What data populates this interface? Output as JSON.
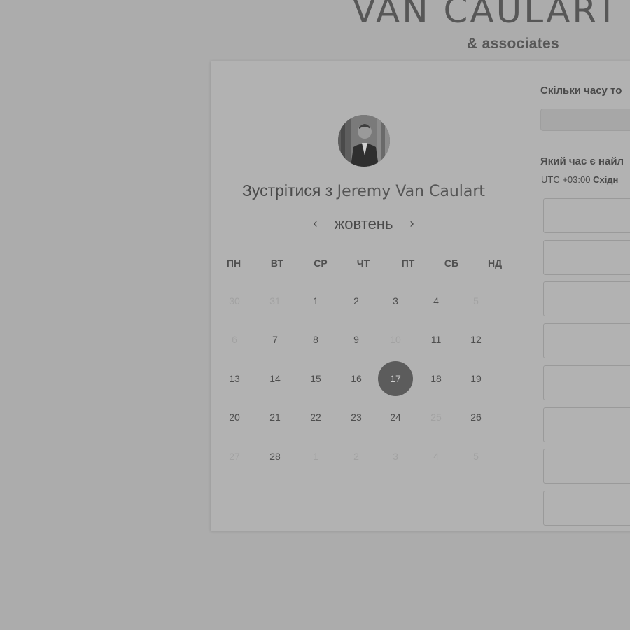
{
  "brand": {
    "title": "VAN CAULART",
    "subtitle": "& associates"
  },
  "scheduler": {
    "meet_prefix": "Зустрітися з",
    "host_name": "Jeremy Van Caulart",
    "month": "жовтень",
    "prev_arrow": "‹",
    "next_arrow": "›",
    "weekdays": [
      "ПН",
      "ВТ",
      "СР",
      "ЧТ",
      "ПТ",
      "СБ",
      "НД"
    ],
    "weeks": [
      [
        {
          "d": "30",
          "muted": true
        },
        {
          "d": "31",
          "muted": true
        },
        {
          "d": "1"
        },
        {
          "d": "2"
        },
        {
          "d": "3"
        },
        {
          "d": "4"
        },
        {
          "d": "5",
          "muted": true
        }
      ],
      [
        {
          "d": "6",
          "muted": true
        },
        {
          "d": "7"
        },
        {
          "d": "8"
        },
        {
          "d": "9"
        },
        {
          "d": "10",
          "muted": true
        },
        {
          "d": "11"
        },
        {
          "d": "12"
        }
      ],
      [
        {
          "d": "13"
        },
        {
          "d": "14"
        },
        {
          "d": "15"
        },
        {
          "d": "16"
        },
        {
          "d": "17",
          "selected": true
        },
        {
          "d": "18"
        },
        {
          "d": "19"
        }
      ],
      [
        {
          "d": "20"
        },
        {
          "d": "21"
        },
        {
          "d": "22"
        },
        {
          "d": "23"
        },
        {
          "d": "24"
        },
        {
          "d": "25",
          "muted": true
        },
        {
          "d": "26"
        }
      ],
      [
        {
          "d": "27",
          "muted": true
        },
        {
          "d": "28"
        },
        {
          "d": "1",
          "muted": true
        },
        {
          "d": "2",
          "muted": true
        },
        {
          "d": "3",
          "muted": true
        },
        {
          "d": "4",
          "muted": true
        },
        {
          "d": "5",
          "muted": true
        }
      ]
    ],
    "selected_day": "17"
  },
  "booking": {
    "duration_label": "Скільки часу то",
    "time_label": "Який час є найл",
    "tz_offset": "UTC +03:00",
    "tz_name": "Східн",
    "slot_count": 8
  },
  "colors": {
    "overlay": "#acacac",
    "selected_day": "#5c5c5c"
  }
}
